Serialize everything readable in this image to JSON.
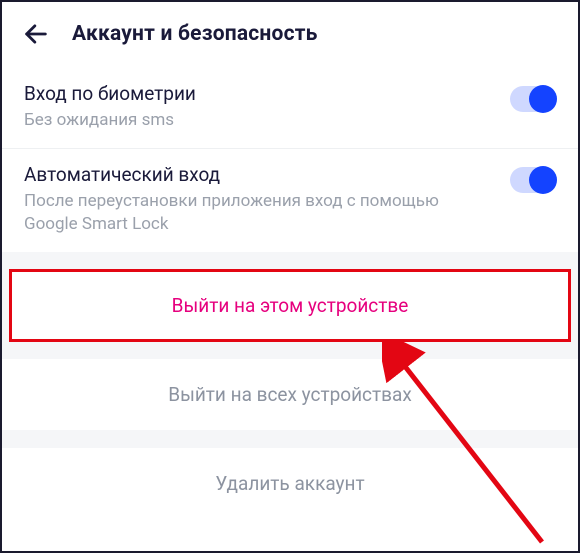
{
  "header": {
    "title": "Аккаунт и безопасность"
  },
  "settings": {
    "biometric": {
      "title": "Вход по биометрии",
      "subtitle": "Без ожидания sms",
      "enabled": true
    },
    "auto_login": {
      "title": "Автоматический вход",
      "subtitle": "После переустановки приложения вход с помощью Google Smart Lock",
      "enabled": true
    }
  },
  "actions": {
    "logout_this": "Выйти на этом устройстве",
    "logout_all": "Выйти на всех устройствах",
    "delete_account": "Удалить аккаунт"
  },
  "colors": {
    "accent_toggle": "#1443ff",
    "highlight_text": "#e6007e",
    "highlight_border": "#e30613",
    "annotation_arrow": "#e30613"
  }
}
